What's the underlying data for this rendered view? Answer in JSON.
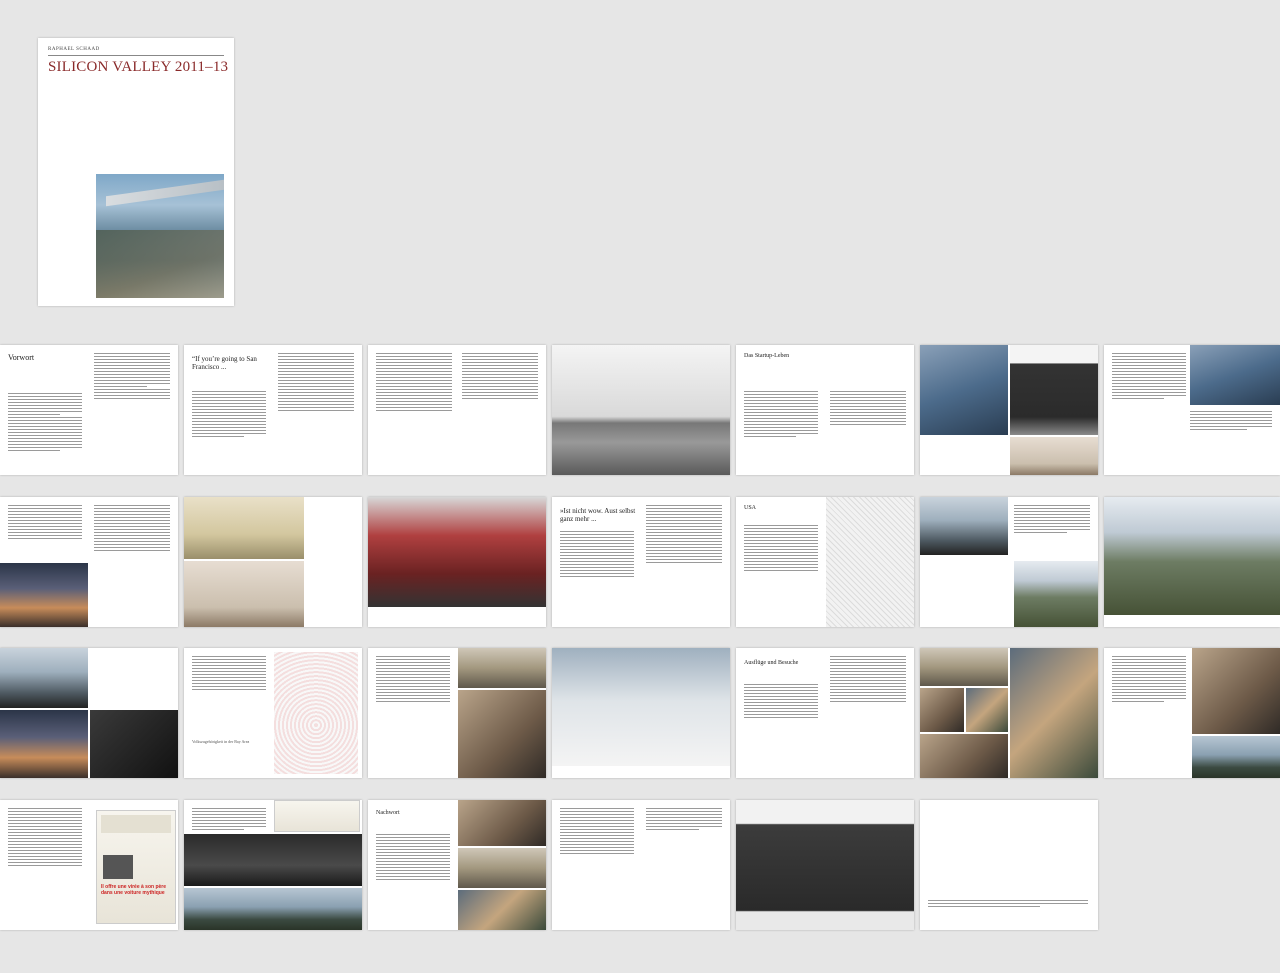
{
  "cover": {
    "author": "RAPHAEL SCHAAD",
    "title": "SILICON VALLEY 2011–13"
  },
  "row1": {
    "vorwort_heading": "Vorwort",
    "chapter1_quote": "“If you’re going to San Francisco ...",
    "startup_heading": "Das Startup-Leben"
  },
  "row2": {
    "chapter_quote": "»Ist nicht wow. Aust selbst ganz mehr ...",
    "usa_heading": "USA"
  },
  "row3": {
    "ausfluge_heading": "Ausflüge und Besuche",
    "legend_title": "Volkszugehörigkeit in der Bay Area"
  },
  "row4": {
    "nachwort_heading": "Nachwort",
    "newspaper_headline": "Il offre une virée à son père dans une voiture mythique"
  }
}
